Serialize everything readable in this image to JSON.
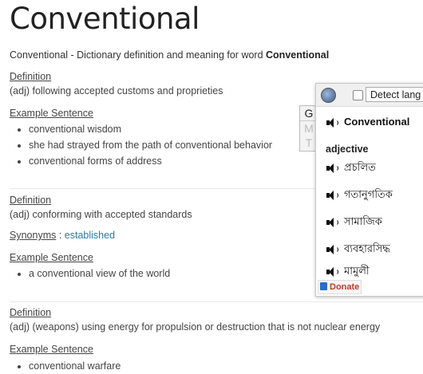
{
  "title": "Conventional",
  "intro": {
    "prefix": "Conventional - Dictionary definition and meaning for word ",
    "word": "Conventional"
  },
  "entries": [
    {
      "definition_label": "Definition",
      "definition": "(adj) following accepted customs and proprieties",
      "example_label": "Example Sentence",
      "examples": [
        "conventional wisdom",
        "she had strayed from the path of conventional behavior",
        "conventional forms of address"
      ]
    },
    {
      "definition_label": "Definition",
      "definition": "(adj) conforming with accepted standards",
      "synonyms_label": "Synonyms",
      "synonyms_sep": " : ",
      "synonym": "established",
      "example_label": "Example Sentence",
      "examples": [
        "a conventional view of the world"
      ]
    },
    {
      "definition_label": "Definition",
      "definition": "(adj) (weapons) using energy for propulsion or destruction that is not nuclear energy",
      "example_label": "Example Sentence",
      "examples": [
        "conventional warfare"
      ]
    }
  ],
  "popup": {
    "detect_label": "Detect lang",
    "tabs": [
      "G",
      "M",
      "T"
    ],
    "word": "Conventional",
    "part_of_speech": "adjective",
    "translations": [
      "প্রচলিত",
      "গতানুগতিক",
      "সামাজিক",
      "ব্যবহারসিদ্ধ",
      "মামুলী"
    ],
    "donate": "Donate"
  },
  "colors": {
    "link": "#2a7ab0",
    "donate": "#c0392b"
  }
}
